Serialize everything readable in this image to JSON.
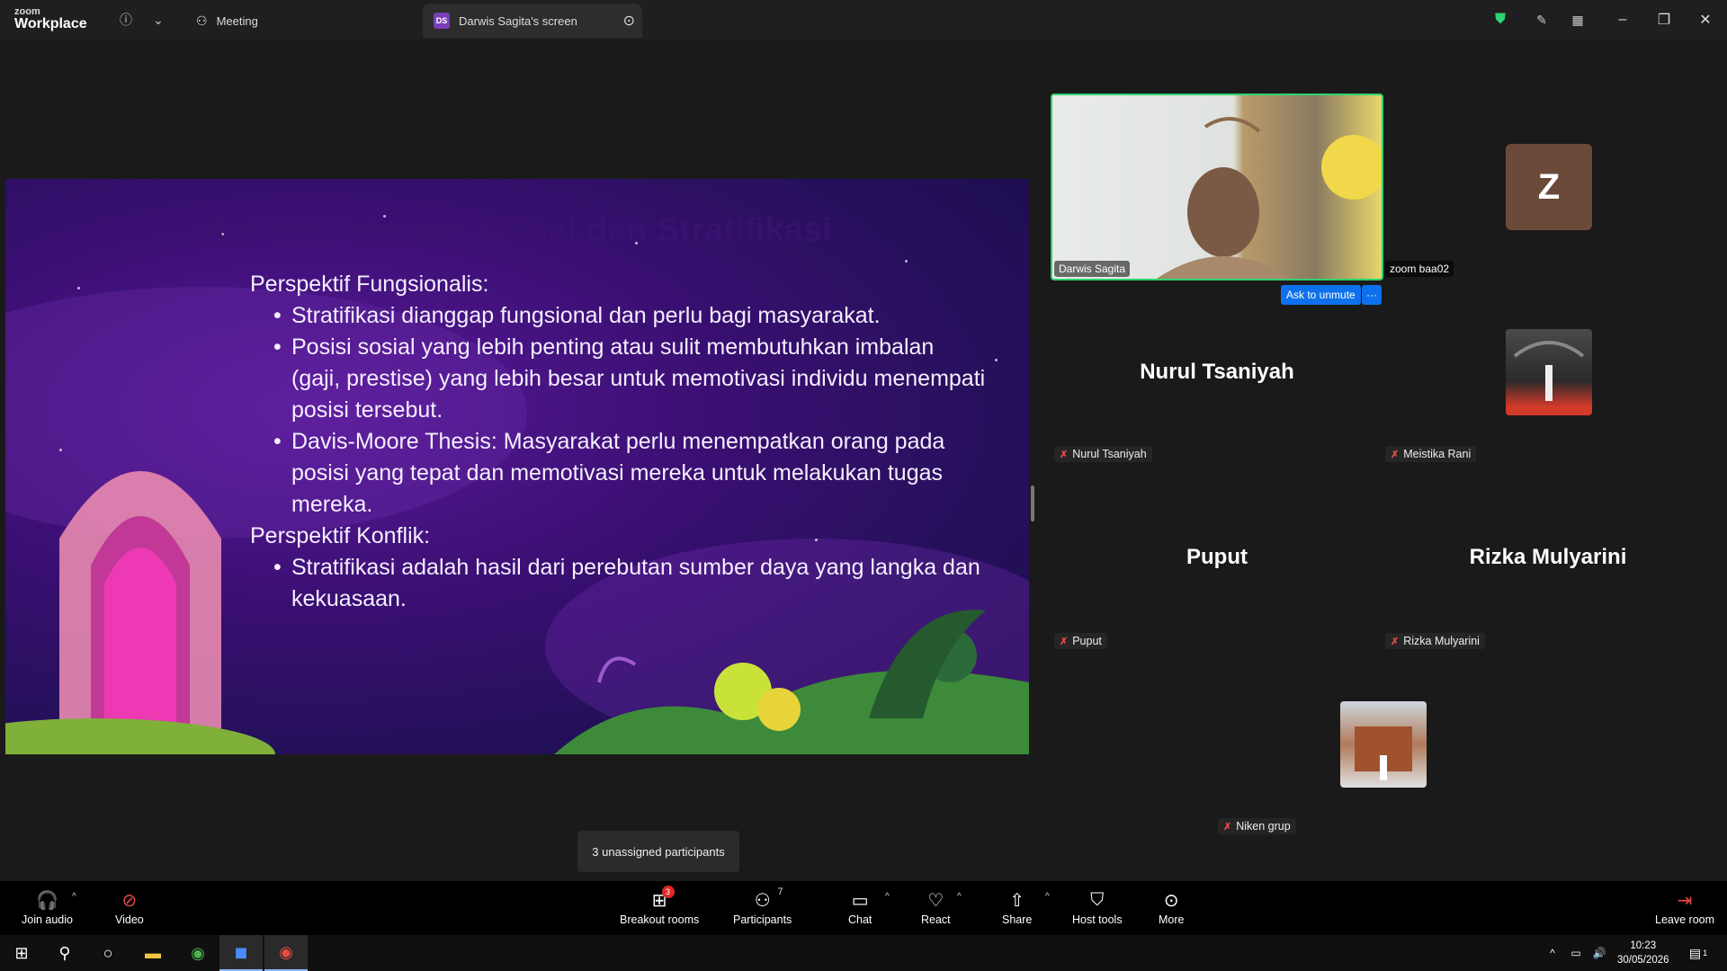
{
  "topbar": {
    "logo_line1": "zoom",
    "logo_line2": "Workplace",
    "tab_meeting": "Meeting",
    "tab_screen_badge": "DS",
    "tab_screen": "Darwis Sagita's screen"
  },
  "slide": {
    "title": "Ketidaksetaraan Sosial dan Stratifikasi",
    "heading1": "Perspektif Fungsionalis:",
    "bullets1": [
      "Stratifikasi dianggap fungsional dan perlu bagi masyarakat.",
      "Posisi sosial yang lebih penting atau sulit membutuhkan imbalan (gaji, prestise) yang lebih besar untuk memotivasi individu menempati posisi tersebut.",
      "Davis-Moore Thesis: Masyarakat perlu menempatkan orang pada posisi yang tepat dan memotivasi mereka untuk melakukan tugas mereka."
    ],
    "heading2": "Perspektif Konflik:",
    "bullets2": [
      "Stratifikasi adalah hasil dari perebutan sumber daya yang langka dan kekuasaan."
    ]
  },
  "participants": {
    "video_name": "Darwis Sagita",
    "ask_unmute": "Ask to unmute",
    "more_dots": "···",
    "zoom_name": "zoom baa02",
    "zoom_avatar": "Z",
    "nurul_big": "Nurul Tsaniyah",
    "nurul_chip": "Nurul Tsaniyah",
    "meistika_chip": "Meistika Rani",
    "puput_big": "Puput",
    "puput_chip": "Puput",
    "rizka_big": "Rizka Mulyarini",
    "rizka_chip": "Rizka Mulyarini",
    "niken_chip": "Niken grup"
  },
  "tooltip": "3 unassigned participants",
  "controls": {
    "join_audio": "Join audio",
    "video": "Video",
    "breakout": "Breakout rooms",
    "breakout_badge": "3",
    "participants": "Participants",
    "participants_count": "7",
    "chat": "Chat",
    "react": "React",
    "share": "Share",
    "host_tools": "Host tools",
    "more": "More",
    "leave": "Leave room"
  },
  "taskbar": {
    "time": "10:23",
    "date": "30/05/2026",
    "notif_count": "1"
  },
  "colors": {
    "speaker_border": "#2dd36f",
    "accent_blue": "#0e71eb",
    "mute_red": "#e54848"
  }
}
